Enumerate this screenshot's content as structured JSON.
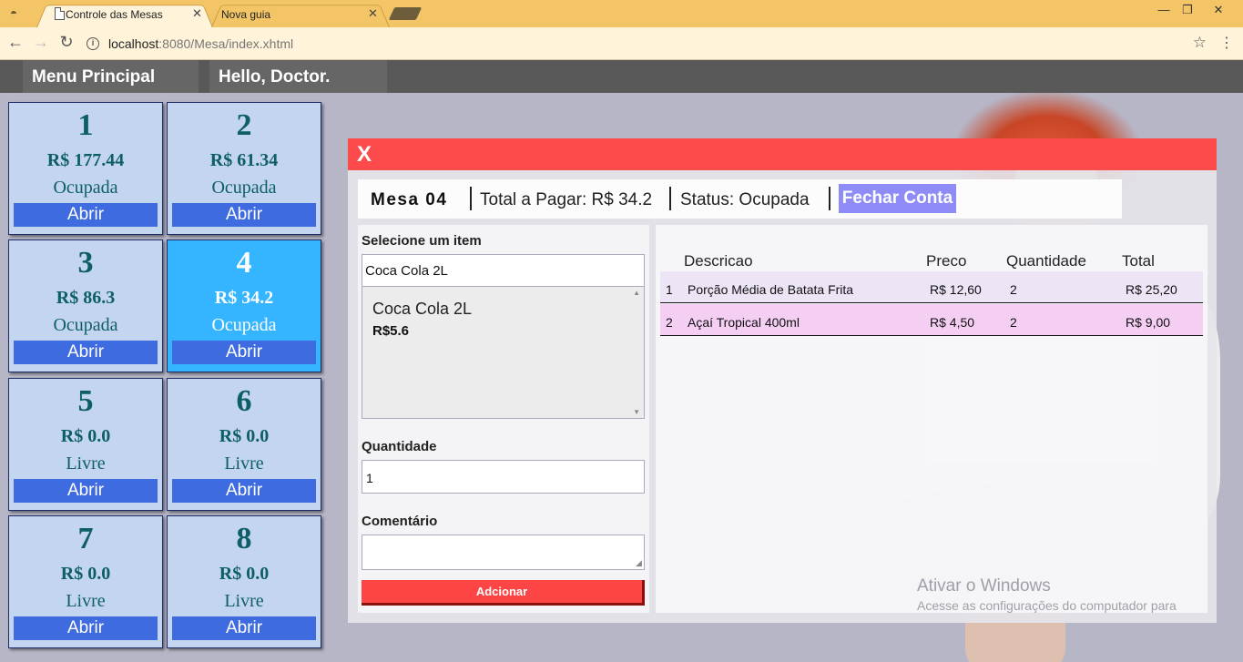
{
  "browser": {
    "tabs": [
      {
        "label": "Controle das Mesas",
        "active": true
      },
      {
        "label": "Nova guia",
        "active": false
      }
    ],
    "url_host": "localhost",
    "url_rest": ":8080/Mesa/index.xhtml",
    "window_buttons": {
      "minimize": "—",
      "restore": "❐",
      "close": "✕"
    }
  },
  "header": {
    "menu": "Menu Principal",
    "greeting": "Hello, Doctor."
  },
  "mesas": [
    {
      "numero": "1",
      "total": "R$ 177.44",
      "status": "Ocupada",
      "button": "Abrir"
    },
    {
      "numero": "2",
      "total": "R$ 61.34",
      "status": "Ocupada",
      "button": "Abrir"
    },
    {
      "numero": "3",
      "total": "R$ 86.3",
      "status": "Ocupada",
      "button": "Abrir"
    },
    {
      "numero": "4",
      "total": "R$ 34.2",
      "status": "Ocupada",
      "button": "Abrir",
      "selected": true
    },
    {
      "numero": "5",
      "total": "R$ 0.0",
      "status": "Livre",
      "button": "Abrir"
    },
    {
      "numero": "6",
      "total": "R$ 0.0",
      "status": "Livre",
      "button": "Abrir"
    },
    {
      "numero": "7",
      "total": "R$ 0.0",
      "status": "Livre",
      "button": "Abrir"
    },
    {
      "numero": "8",
      "total": "R$ 0.0",
      "status": "Livre",
      "button": "Abrir"
    }
  ],
  "dialog": {
    "close_label": "X",
    "mesa_label": "Mesa 04",
    "total_label": "Total a Pagar: R$ 34.2",
    "status_label": "Status: Ocupada",
    "fechar_label": "Fechar Conta",
    "form": {
      "select_label": "Selecione um item",
      "select_value": "Coca Cola 2L",
      "list_item_name": "Coca Cola 2L",
      "list_item_price": "R$5.6",
      "quantidade_label": "Quantidade",
      "quantidade_value": "1",
      "comentario_label": "Comentário",
      "comentario_value": "",
      "add_button": "Adcionar"
    },
    "table": {
      "headers": [
        "Descricao",
        "Preco",
        "Quantidade",
        "Total"
      ],
      "rows": [
        {
          "idx": "1",
          "descricao": "Porção Média de Batata Frita",
          "preco": "R$ 12,60",
          "quantidade": "2",
          "total": "R$ 25,20"
        },
        {
          "idx": "2",
          "descricao": "Açaí Tropical 400ml",
          "preco": "R$ 4,50",
          "quantidade": "2",
          "total": "R$ 9,00"
        }
      ]
    }
  },
  "watermark": {
    "line1": "Ativar o Windows",
    "line2": "Acesse as configurações do computador para"
  },
  "colors": {
    "accent_red": "#fd4a4a",
    "mesa_bg": "#c3d5ef",
    "mesa_selected": "#35b5ff",
    "abrir_blue": "#3e6bdf",
    "fechar_purple": "#8f8cf7",
    "row1": "#ede5f6",
    "row2": "#f5cff3"
  }
}
